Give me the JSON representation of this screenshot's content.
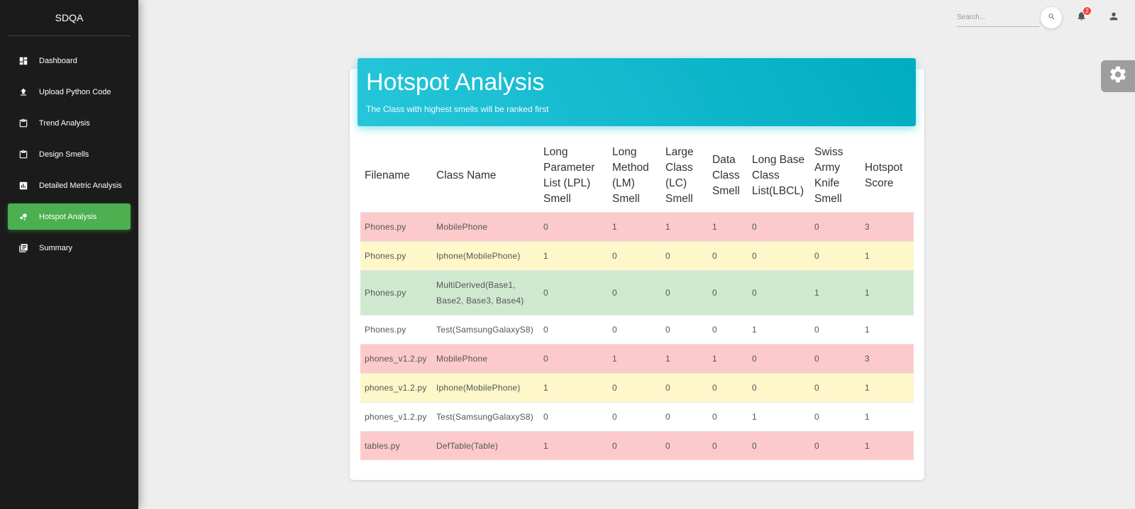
{
  "sidebar": {
    "brand": "SDQA",
    "items": [
      {
        "label": "Dashboard",
        "icon": "dashboard-icon",
        "active": false
      },
      {
        "label": "Upload Python Code",
        "icon": "upload-icon",
        "active": false
      },
      {
        "label": "Trend Analysis",
        "icon": "clipboard-icon",
        "active": false
      },
      {
        "label": "Design Smells",
        "icon": "clipboard-icon",
        "active": false
      },
      {
        "label": "Detailed Metric Analysis",
        "icon": "bar-chart-icon",
        "active": false
      },
      {
        "label": "Hotspot Analysis",
        "icon": "bubble-chart-icon",
        "active": true
      },
      {
        "label": "Summary",
        "icon": "library-books-icon",
        "active": false
      }
    ]
  },
  "topbar": {
    "search_placeholder": "Search...",
    "notification_count": "2"
  },
  "card": {
    "title": "Hotspot Analysis",
    "subtitle": "The Class with highest smells will be ranked first"
  },
  "table": {
    "headers": [
      {
        "lines": [
          "Filename"
        ]
      },
      {
        "lines": [
          "Class Name"
        ]
      },
      {
        "lines": [
          "Long",
          "Parameter",
          "List (LPL)",
          "Smell"
        ]
      },
      {
        "lines": [
          "Long",
          "Method",
          "(LM)",
          "Smell"
        ]
      },
      {
        "lines": [
          "Large",
          "Class",
          "(LC)",
          "Smell"
        ]
      },
      {
        "lines": [
          "Data",
          "Class",
          "Smell"
        ]
      },
      {
        "lines": [
          "Long Base",
          "Class",
          "List(LBCL)"
        ]
      },
      {
        "lines": [
          "Swiss",
          "Army",
          "Knife",
          "Smell"
        ]
      },
      {
        "lines": [
          "Hotspot",
          "Score"
        ]
      }
    ],
    "rows": [
      {
        "status": "danger",
        "cells": [
          "Phones.py",
          "MobilePhone",
          "0",
          "1",
          "1",
          "1",
          "0",
          "0",
          "3"
        ]
      },
      {
        "status": "warning",
        "cells": [
          "Phones.py",
          "Iphone(MobilePhone)",
          "1",
          "0",
          "0",
          "0",
          "0",
          "0",
          "1"
        ]
      },
      {
        "status": "success",
        "cells": [
          "Phones.py",
          "MultiDerived(Base1, Base2, Base3, Base4)",
          "0",
          "0",
          "0",
          "0",
          "0",
          "1",
          "1"
        ]
      },
      {
        "status": "plain",
        "cells": [
          "Phones.py",
          "Test(SamsungGalaxyS8)",
          "0",
          "0",
          "0",
          "0",
          "1",
          "0",
          "1"
        ]
      },
      {
        "status": "danger",
        "cells": [
          "phones_v1.2.py",
          "MobilePhone",
          "0",
          "1",
          "1",
          "1",
          "0",
          "0",
          "3"
        ]
      },
      {
        "status": "warning",
        "cells": [
          "phones_v1.2.py",
          "Iphone(MobilePhone)",
          "1",
          "0",
          "0",
          "0",
          "0",
          "0",
          "1"
        ]
      },
      {
        "status": "plain",
        "cells": [
          "phones_v1.2.py",
          "Test(SamsungGalaxyS8)",
          "0",
          "0",
          "0",
          "0",
          "1",
          "0",
          "1"
        ]
      },
      {
        "status": "danger",
        "cells": [
          "tables.py",
          "DefTable(Table)",
          "1",
          "0",
          "0",
          "0",
          "0",
          "0",
          "1"
        ]
      }
    ]
  },
  "colors": {
    "sidebar_bg": "#1b1b1b",
    "active_item": "#4caf50",
    "header_gradient_start": "#26c6da",
    "header_gradient_end": "#00acc1",
    "row_danger": "#fccaca",
    "row_warning": "#fdf7c9",
    "row_success": "#cfe9cf",
    "badge": "#f44336"
  }
}
